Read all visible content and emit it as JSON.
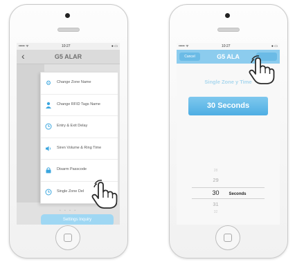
{
  "left_screen": {
    "status": {
      "carrier": "••••• Ὗ9",
      "time": "10:27",
      "battery": "● 100%"
    },
    "title": "G5 ALAR",
    "menu_items": [
      {
        "icon": "gear-icon",
        "label": "Change Zone Name"
      },
      {
        "icon": "person-icon",
        "label": "Change RFID Tags Name"
      },
      {
        "icon": "clock-icon",
        "label": "Entry & Exit Delay"
      },
      {
        "icon": "speaker-icon",
        "label": "Siren Volume & Ring Time"
      },
      {
        "icon": "lock-icon",
        "label": "Disarm Passcode"
      },
      {
        "icon": "clock-icon",
        "label": "Single Zone Del"
      }
    ],
    "page_dots": "• • • •",
    "settings_inquiry_label": "Settings Inquiry"
  },
  "right_screen": {
    "status": {
      "carrier": "••••• Ὗ9",
      "time": "10:27",
      "battery": "● 100%"
    },
    "cancel_label": "Cancel",
    "title": "G5 ALA",
    "setting_heading": "Single Zone     y Time",
    "value_display": "30 Seconds",
    "picker": {
      "rows": [
        "28",
        "29",
        "30",
        "31",
        "32"
      ],
      "selected_index": 2,
      "unit": "Seconds"
    }
  },
  "colors": {
    "accent": "#4eaee3",
    "light_accent": "#9fd7f3",
    "icon_blue": "#3aa6df"
  }
}
